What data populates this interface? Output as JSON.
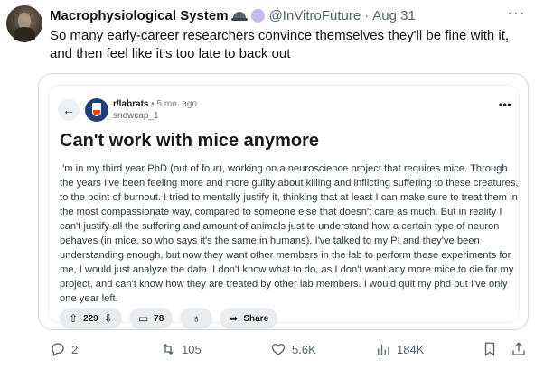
{
  "tweet": {
    "display_name": "Macrophysiological System",
    "handle": "@InVitroFuture",
    "separator": "·",
    "date": "Aug 31",
    "more": "···",
    "text": "So many early-career researchers convince themselves they'll be fine with it, and then feel like it's too late to back out"
  },
  "reddit": {
    "subreddit": "r/labrats",
    "age": " • 5 mo. ago",
    "username": "snowcap_1",
    "more": "•••",
    "back": "←",
    "title": "Can't work with mice anymore",
    "body": "I'm in my third year PhD (out of four), working on a neuroscience project that requires mice. Through the years I've been feeling more and more guilty about killing and inflicting suffering to these creatures, to the point of burnout. I tried to mentally justify it, thinking that at least I can make sure to treat them in the most compassionate way, compared to someone else that doesn't care as much. But in reality I can't justify all the suffering and amount of animals just to understand how a certain type of neuron behaves (in mice, so who says it's the same in humans). I've talked to my PI and they've been understanding enough, but now they want other members in the lab to perform these experiments for me, I would just analyze the data. I don't know what to do, as I don't want any more mice to die for my project, and can't know how they are treated by other lab members. I would quit my phd but I've only one year left.",
    "votes": "229",
    "comments": "78",
    "share_label": "Share",
    "icons": {
      "upvote": "upvote-icon",
      "downvote": "downvote-icon",
      "comment": "comment-icon",
      "award": "award-icon",
      "share": "share-icon"
    }
  },
  "actions": {
    "replies": "2",
    "reposts": "105",
    "likes": "5.6K",
    "views": "184K"
  },
  "colors": {
    "text": "#0f1419",
    "secondary": "#536471",
    "border": "#cfd9de",
    "pill": "#eaedef"
  }
}
